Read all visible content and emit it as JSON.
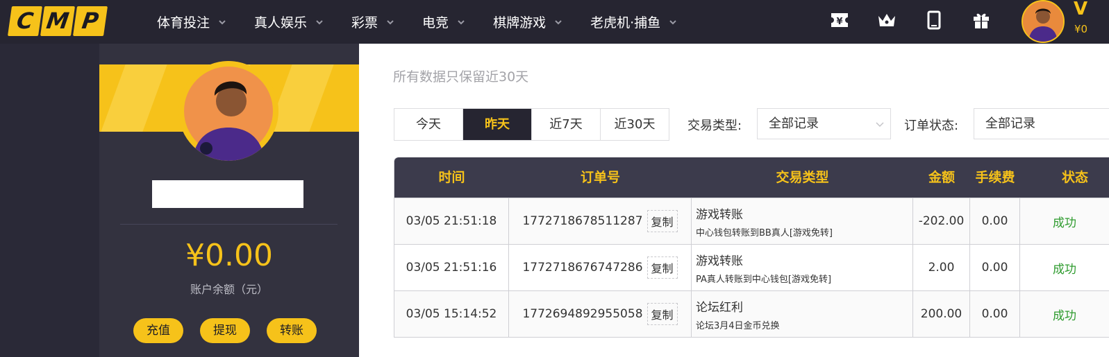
{
  "logo": {
    "letters": [
      "C",
      "M",
      "P"
    ]
  },
  "nav": {
    "items": [
      {
        "label": "体育投注"
      },
      {
        "label": "真人娱乐"
      },
      {
        "label": "彩票"
      },
      {
        "label": "电竞"
      },
      {
        "label": "棋牌游戏"
      },
      {
        "label": "老虎机·捕鱼"
      }
    ]
  },
  "header": {
    "icons": [
      "ticket-icon",
      "crown-icon",
      "mobile-icon",
      "gift-icon"
    ],
    "vip_label": "V",
    "balance_prefix": "¥0"
  },
  "sidebar": {
    "balance": "¥0.00",
    "balance_label": "账户余额（元）",
    "actions": [
      "充值",
      "提现",
      "转账"
    ]
  },
  "main": {
    "notice": "所有数据只保留近30天",
    "date_tabs": [
      {
        "label": "今天",
        "active": false
      },
      {
        "label": "昨天",
        "active": true
      },
      {
        "label": "近7天",
        "active": false
      },
      {
        "label": "近30天",
        "active": false
      }
    ],
    "filters": {
      "type_label": "交易类型:",
      "type_value": "全部记录",
      "status_label": "订单状态:",
      "status_value": "全部记录"
    },
    "table": {
      "headers": [
        "时间",
        "订单号",
        "交易类型",
        "金额",
        "手续费",
        "状态"
      ],
      "copy_label": "复制",
      "rows": [
        {
          "time": "03/05 21:51:18",
          "order": "1772718678511287",
          "type": "游戏转账",
          "type_detail": "中心钱包转账到BB真人[游戏免转]",
          "amount": "-202.00",
          "fee": "0.00",
          "status": "成功"
        },
        {
          "time": "03/05 21:51:16",
          "order": "1772718676747286",
          "type": "游戏转账",
          "type_detail": "PA真人转账到中心钱包[游戏免转]",
          "amount": "2.00",
          "fee": "0.00",
          "status": "成功"
        },
        {
          "time": "03/05 15:14:52",
          "order": "1772694892955058",
          "type": "论坛红利",
          "type_detail": "论坛3月4日金币兑换",
          "amount": "200.00",
          "fee": "0.00",
          "status": "成功"
        }
      ]
    }
  },
  "colors": {
    "accent": "#f6c21a",
    "dark": "#262531",
    "success": "#2e9b2e"
  }
}
